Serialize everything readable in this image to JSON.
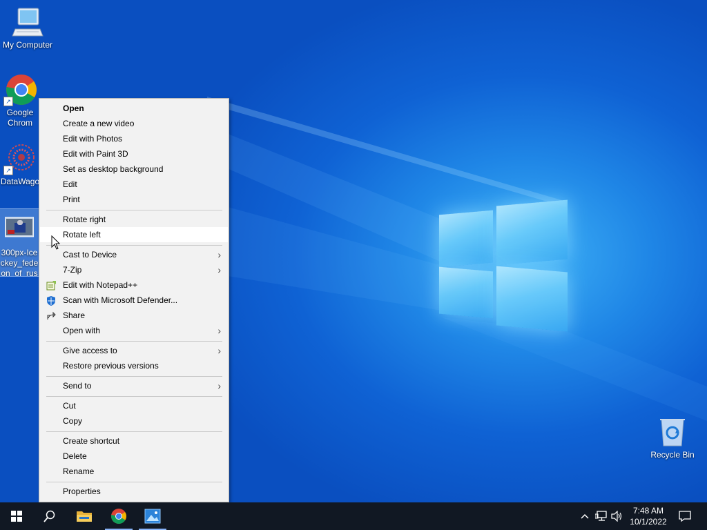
{
  "desktop_icons": [
    {
      "name": "My Computer",
      "icon": "computer-icon"
    },
    {
      "name": "Google Chrom",
      "icon": "chrome-icon",
      "shortcut": true
    },
    {
      "name": "DataWago",
      "icon": "datawagon-icon",
      "shortcut": true
    },
    {
      "name": "300px-Ice ckey_fede on_of_rus",
      "icon": "image-file-icon"
    },
    {
      "name": "Recycle Bin",
      "icon": "recycle-bin-icon"
    }
  ],
  "context_menu": {
    "items": [
      {
        "label": "Open",
        "bold": true
      },
      {
        "label": "Create a new video"
      },
      {
        "label": "Edit with Photos"
      },
      {
        "label": "Edit with Paint 3D"
      },
      {
        "label": "Set as desktop background"
      },
      {
        "label": "Edit"
      },
      {
        "label": "Print"
      },
      {
        "label": "Rotate right"
      },
      {
        "label": "Rotate left",
        "highlighted": true
      },
      {
        "label": "Cast to Device",
        "submenu": true
      },
      {
        "label": "7-Zip",
        "submenu": true
      },
      {
        "label": "Edit with Notepad++",
        "icon": "notepad-plus-plus-icon"
      },
      {
        "label": "Scan with Microsoft Defender...",
        "icon": "defender-shield-icon"
      },
      {
        "label": "Share",
        "icon": "share-icon"
      },
      {
        "label": "Open with",
        "submenu": true
      },
      {
        "label": "Give access to",
        "submenu": true
      },
      {
        "label": "Restore previous versions"
      },
      {
        "label": "Send to",
        "submenu": true
      },
      {
        "label": "Cut"
      },
      {
        "label": "Copy"
      },
      {
        "label": "Create shortcut"
      },
      {
        "label": "Delete"
      },
      {
        "label": "Rename"
      },
      {
        "label": "Properties"
      }
    ]
  },
  "taskbar": {
    "buttons": [
      "start-icon",
      "search-icon",
      "file-explorer-icon",
      "chrome-icon",
      "photos-icon"
    ],
    "tray": [
      "chevron-up-icon",
      "network-icon",
      "volume-icon"
    ],
    "time": "7:48 AM",
    "date": "10/1/2022",
    "notification_icon": "notification-icon"
  },
  "colors": {
    "desktop_blue": "#0f62d4",
    "taskbar": "#111823",
    "menu_bg": "#f2f2f2"
  }
}
